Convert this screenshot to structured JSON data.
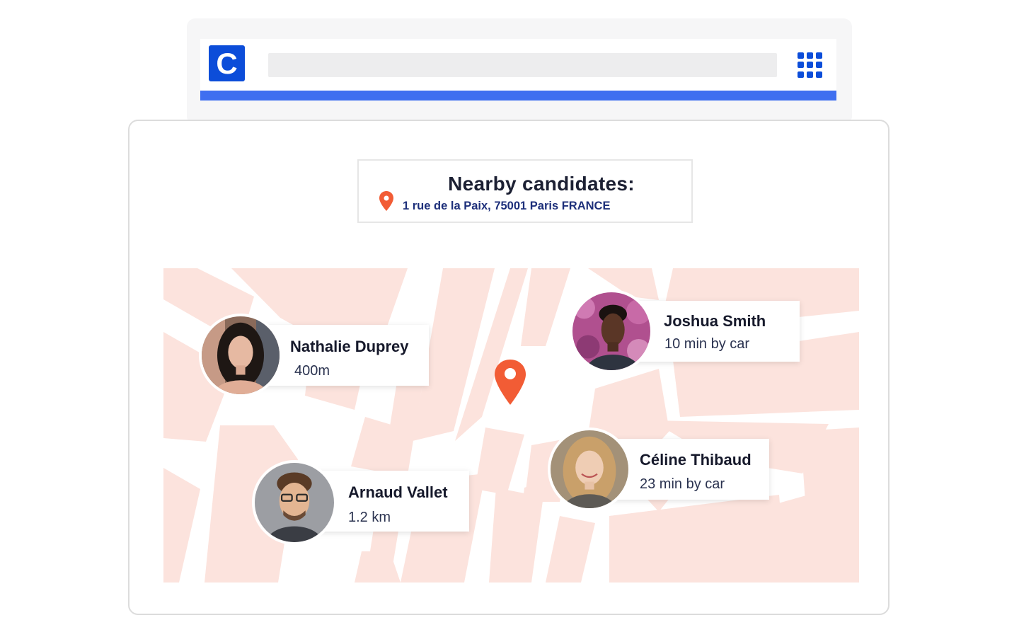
{
  "app": {
    "logo_letter": "C",
    "brand_color": "#0c4dd9",
    "accent_color": "#3f6ff0",
    "search_placeholder": "",
    "apps_icon": "grid-icon"
  },
  "header": {
    "title": "Nearby candidates:",
    "address": "1 rue de la Paix, 75001 Paris FRANCE",
    "pin_icon": "map-pin-icon",
    "pin_color": "#f25c35"
  },
  "map": {
    "block_color": "#fce3dd",
    "center_pin_icon": "map-pin-icon"
  },
  "candidates": [
    {
      "name": "Nathalie Duprey",
      "distance": "400m"
    },
    {
      "name": "Joshua Smith",
      "distance": "10 min by car"
    },
    {
      "name": "Arnaud Vallet",
      "distance": "1.2 km"
    },
    {
      "name": "Céline Thibaud",
      "distance": "23 min by car"
    }
  ]
}
